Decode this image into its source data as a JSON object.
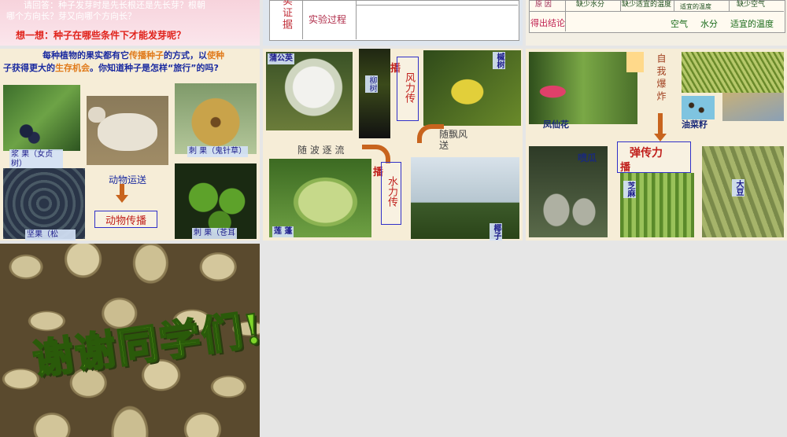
{
  "slide1": {
    "line1": "请回答：种子发芽时是先长根还是先长芽？根朝",
    "line2": "哪个方向长？芽又向哪个方向长？",
    "question": "想一想：种子在哪些条件下才能发芽呢？"
  },
  "slide2": {
    "label1": "实",
    "label2": "证",
    "label3": "据",
    "process": "实验过程"
  },
  "slide3": {
    "row1_header": "原 因",
    "row1": [
      "缺少水分",
      "缺少适宜的温度",
      "适宜的温度",
      "缺少空气"
    ],
    "conclusion_header": "得出结论",
    "conclusion": [
      "空气",
      "水分",
      "适宜的温度"
    ]
  },
  "slide4": {
    "intro_pre": "每种植物的果实都有它",
    "intro_hl1": "传播种子",
    "intro_mid": "的方式，以",
    "intro_hl2": "使种",
    "intro_line2_pre": "子获得更大的",
    "intro_hl3": "生存机会",
    "intro_line2_post": "。你知道种子是怎样“旅行”的吗?",
    "caption_1": "浆 果（女贞树）",
    "caption_2": "刺 果（鬼针草）",
    "caption_3": "坚果（松",
    "caption_4": "刺 果（苍耳",
    "animal_transport": "动物运送",
    "animal_spread": "动物传播"
  },
  "slide5": {
    "pugongying": "蒲公英",
    "liushu": "柳树",
    "fengshu": "槭树",
    "bo": "播",
    "wind": "风力传",
    "wind_drift": "随飘风送",
    "wave": "随 波 逐 流",
    "bo2": "播",
    "water": "水力传",
    "lianpeng": "莲 蓬",
    "yezi": "椰子"
  },
  "slide6": {
    "fengxianhua": "凤仙花",
    "self_burst": "自我爆炸",
    "youcaizi": "油菜籽",
    "penggua": "喷瓜",
    "elastic": "弹传力",
    "bo": "播",
    "zhima": "芝麻",
    "dadou": "大豆"
  },
  "slide7": {
    "thanks": "谢谢同学们!"
  }
}
